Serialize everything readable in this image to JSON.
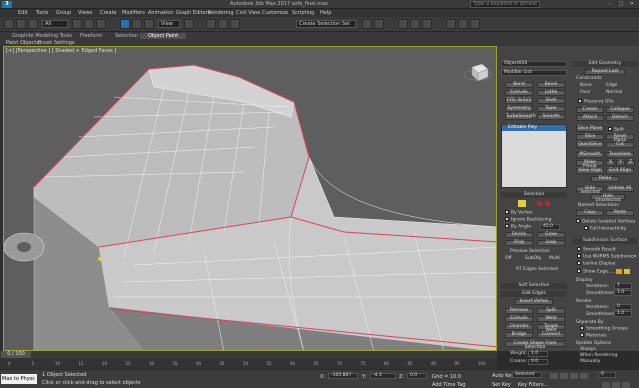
{
  "window": {
    "title": "Autodesk 3ds Max 2017  sofa_final.max",
    "search_placeholder": "Type a keyword or phrase",
    "app_label": "3",
    "controls": [
      "–",
      "□",
      "✕"
    ]
  },
  "menu": [
    "Edit",
    "Tools",
    "Group",
    "Views",
    "Create",
    "Modifiers",
    "Animation",
    "Graph Editors",
    "Rendering",
    "Civil View",
    "Customize",
    "Scripting",
    "Help"
  ],
  "toolbar": {
    "filter": "All",
    "view": "View",
    "selection_set": "Create Selection Set"
  },
  "ribbon": {
    "tabs": [
      "Graphite Modeling Tools",
      "Freeform",
      "Selection",
      "Object Paint"
    ],
    "active_tab": "Object Paint",
    "subtabs": [
      "Paint Objects",
      "Brush Settings"
    ]
  },
  "viewport": {
    "label": "[+] [Perspective ] [ Shaded + Edged Faces ]",
    "bg_color": "#5e5e5e",
    "mesh_color": "#c6c6c6",
    "edge_color": "#e04050"
  },
  "modifier": {
    "object_name": "Object016",
    "list_label": "Modifier List",
    "buttons": [
      "Bend",
      "Bevel",
      "Extrude",
      "Lathe",
      "FFD 3x3x3",
      "Shell",
      "Symmetry",
      "Taper",
      "TurboSmooth",
      "Smooth"
    ],
    "stack_item": "Editable Poly"
  },
  "selection_panel": {
    "header": "Selection",
    "by_vertex": "By Vertex",
    "ignore_backfacing": "Ignore Backfacing",
    "by_angle": "By Angle",
    "angle_value": "45.0",
    "shrink": "Shrink",
    "grow": "Grow",
    "ring": "Ring",
    "loop": "Loop",
    "preview_label": "Preview Selection",
    "preview_options": [
      "Off",
      "SubObj",
      "Multi"
    ],
    "status": "97 Edges Selected"
  },
  "soft_selection": "Soft Selection",
  "edit_edges": {
    "header": "Edit Edges",
    "insert_vertex": "Insert Vertex",
    "buttons": [
      "Remove",
      "Split",
      "Extrude",
      "Weld",
      "Chamfer",
      "Target Weld",
      "Bridge",
      "Connect"
    ],
    "create_shape": "Create Shape From Selection",
    "weight_label": "Weight:",
    "weight_value": "1.0",
    "crease_label": "Crease:",
    "crease_value": "0.0"
  },
  "edit_geometry": {
    "header": "Edit Geometry",
    "repeat_last": "Repeat Last",
    "constraints": "Constraints",
    "constraint_options": [
      "None",
      "Edge",
      "Face",
      "Normal"
    ],
    "preserve_uvs": "Preserve UVs",
    "create": "Create",
    "collapse": "Collapse",
    "attach": "Attach",
    "detach": "Detach",
    "slice_plane": "Slice Plane",
    "split": "Split",
    "slice": "Slice",
    "reset_plane": "Reset Plane",
    "quickslice": "QuickSlice",
    "cut": "Cut",
    "msmooth": "MSmooth",
    "tessellate": "Tessellate",
    "make_planar": "Make Planar",
    "xyz": [
      "X",
      "Y",
      "Z"
    ],
    "view_align": "View Align",
    "grid_align": "Grid Align",
    "relax": "Relax",
    "hide_selected": "Hide Selected",
    "unhide_all": "Unhide All",
    "hide_unselected": "Hide Unselected",
    "named_selections": "Named Selections:",
    "copy": "Copy",
    "paste": "Paste",
    "delete_isolated": "Delete Isolated Vertices",
    "full_interactivity": "Full Interactivity"
  },
  "subdivision": {
    "header": "Subdivision Surface",
    "smooth_result": "Smooth Result",
    "use_nurms": "Use NURMS Subdivision",
    "isoline": "Isoline Display",
    "show_cage": "Show Cage......",
    "display": "Display",
    "iterations_label": "Iterations:",
    "iterations_value": "1",
    "smoothness_label": "Smoothness:",
    "smoothness_value": "1.0",
    "render": "Render",
    "render_iterations": "0",
    "render_smoothness": "1.0",
    "separate_by": "Separate By",
    "smoothing_groups": "Smoothing Groups",
    "materials": "Materials",
    "update_options": "Update Options",
    "always": "Always",
    "when_rendering": "When Rendering",
    "manually": "Manually"
  },
  "timeline": {
    "frame": "0 / 100",
    "ticks": [
      "0",
      "5",
      "10",
      "15",
      "20",
      "25",
      "30",
      "35",
      "40",
      "45",
      "50",
      "55",
      "60",
      "65",
      "70",
      "75",
      "80",
      "85",
      "90",
      "95",
      "100"
    ]
  },
  "status": {
    "maxscript": "Max to Physc",
    "selected": "1 Object Selected",
    "hint": "Click or click-and-drag to select objects",
    "x_label": "X:",
    "x_value": "-105.867",
    "y_label": "Y:",
    "y_value": "-4.3",
    "z_label": "Z:",
    "z_value": "0.0",
    "grid": "Grid = 10.0",
    "add_time_tag": "Add Time Tag",
    "auto_key": "Auto Key",
    "selected_dropdown": "Selected",
    "set_key": "Set Key",
    "key_filters": "Key Filters...",
    "frame_value": "0"
  }
}
